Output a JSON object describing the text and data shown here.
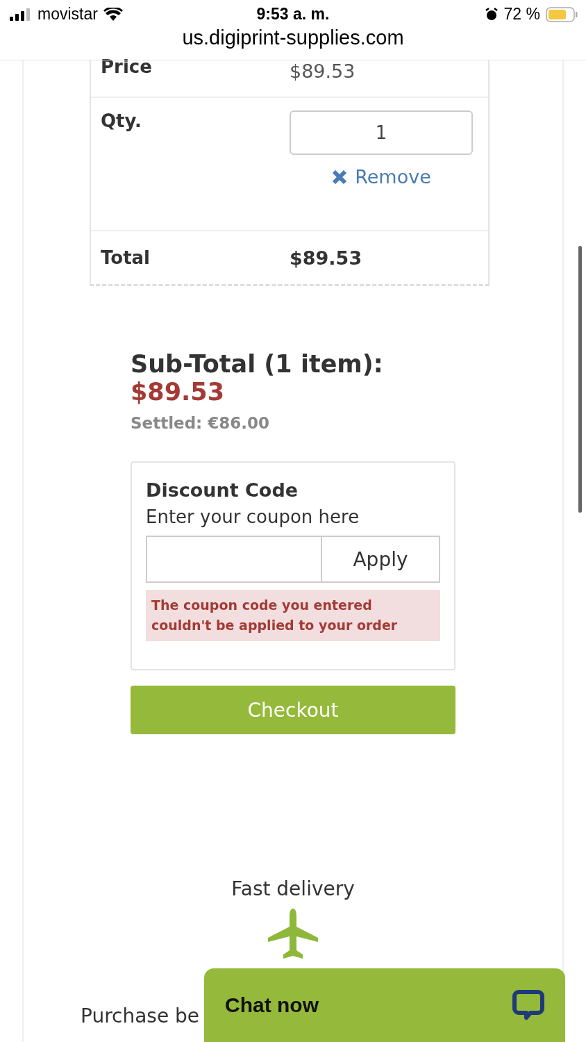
{
  "status_bar": {
    "carrier": "movistar",
    "time": "9:53 a. m.",
    "battery": "72 %",
    "url": "us.digiprint-supplies.com"
  },
  "cart_item": {
    "rows": [
      {
        "kind": "text",
        "label": "Price",
        "value": "$89.53"
      },
      {
        "kind": "qty",
        "label": "Qty.",
        "value": "1",
        "remove": "Remove"
      },
      {
        "kind": "total",
        "label": "Total",
        "value": "$89.53"
      }
    ]
  },
  "summary": {
    "title": "Sub-Total (1 item):",
    "amount": "$89.53",
    "settled": "Settled: €86.00"
  },
  "discount": {
    "title": "Discount Code",
    "subtitle": "Enter your coupon here",
    "button": "Apply",
    "error": "The coupon code you entered couldn't be applied to your order"
  },
  "checkout": "Checkout",
  "delivery": {
    "title": "Fast delivery",
    "text": "Purchase be"
  },
  "chat": {
    "label": "Chat now"
  }
}
